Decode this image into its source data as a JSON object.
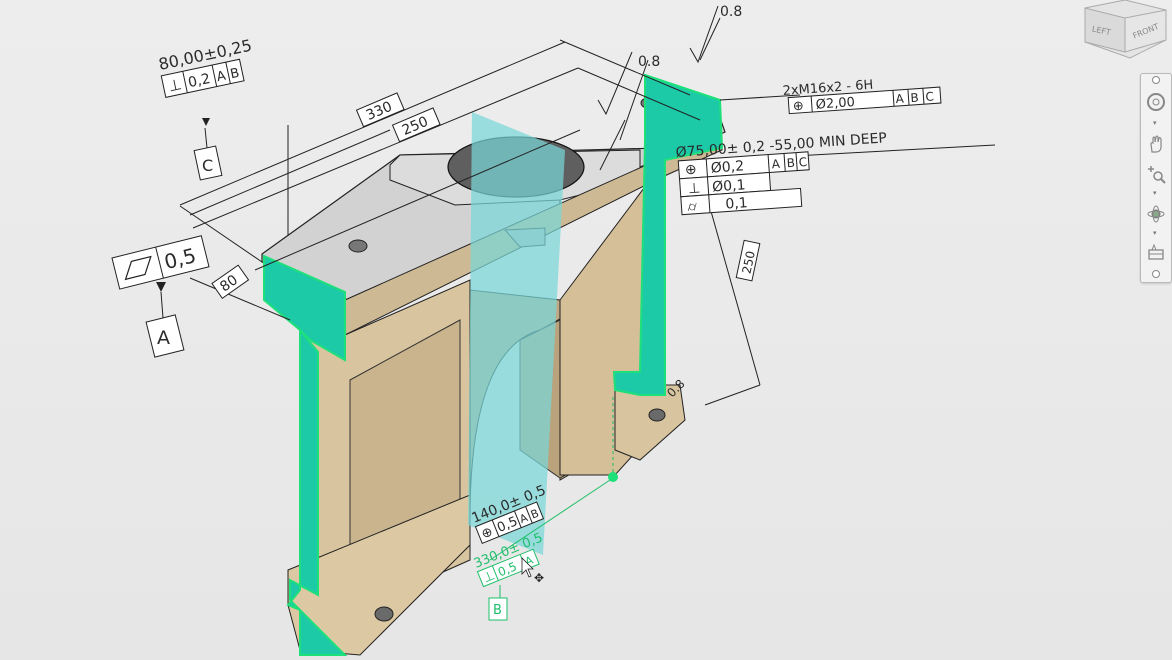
{
  "viewcube": {
    "left": "LEFT",
    "front": "FRONT"
  },
  "annotations": {
    "top_size": "80,00±0,25",
    "perp_tol": "0,2",
    "perp_ref_a": "A",
    "perp_ref_b": "B",
    "datum_c": "C",
    "flatness_tol": "0,5",
    "datum_a": "A",
    "dim_330_top": "330",
    "dim_250": "250",
    "dim_80": "80",
    "roughness_top": "0.8",
    "roughness_mid": "0.8",
    "roughness_right": "0.8",
    "thread_callout": "2xM16x2 - 6H",
    "thread_pos": "Ø2,00",
    "thread_ref_a": "A",
    "thread_ref_b": "B",
    "thread_ref_c": "C",
    "hole_callout": "Ø75,00± 0,2 -55,00 MIN DEEP",
    "hole_pos": "Ø0,2",
    "hole_ref_a": "A",
    "hole_ref_b": "B",
    "hole_ref_c": "C",
    "hole_perp": "Ø0,1",
    "hole_cyl": "0,1",
    "dim_250_vertical": "250",
    "dim_140": "140,0± 0,5",
    "pos_140": "0,5",
    "pos_140_ref_a": "A",
    "pos_140_ref_b": "B",
    "dim_330_green": "330,0± 0,5",
    "perp_green": "0,5",
    "perp_green_ref": "A",
    "datum_b": "B"
  }
}
